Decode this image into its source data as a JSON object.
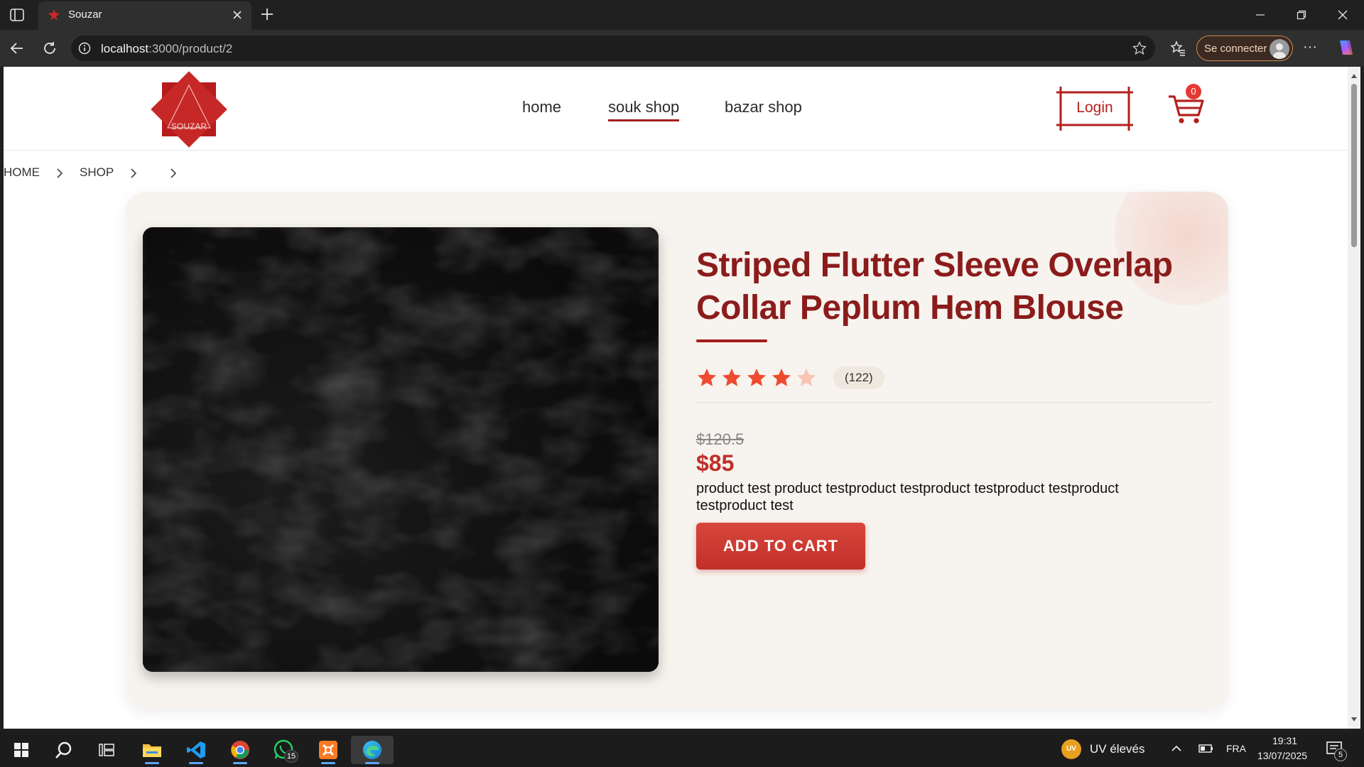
{
  "browser": {
    "tab_title": "Souzar",
    "url_host": "localhost",
    "url_path": ":3000/product/2",
    "signin_label": "Se connecter"
  },
  "site": {
    "logo_text": "SOUZAR",
    "nav": [
      {
        "label": "home"
      },
      {
        "label": "souk shop"
      },
      {
        "label": "bazar shop"
      }
    ],
    "login_label": "Login",
    "cart_count": "0"
  },
  "breadcrumb": [
    "HOME",
    "SHOP"
  ],
  "product": {
    "title": "Striped Flutter Sleeve Overlap Collar Peplum Hem Blouse",
    "rating": 4,
    "rating_max": 5,
    "review_count": "(122)",
    "old_price": "$120.5",
    "price": "$85",
    "description": "product test product testproduct testproduct testproduct testproduct testproduct test",
    "cta_label": "ADD TO CART"
  },
  "taskbar": {
    "whatsapp_badge": "15",
    "weather_label": "UV élevés",
    "weather_badge": "UV",
    "language": "FRA",
    "time": "19:31",
    "date": "13/07/2025",
    "notification_count": "5"
  },
  "colors": {
    "brand_red": "#8b1c1c",
    "accent_red": "#c0302a",
    "card_bg": "#f7f3ee"
  }
}
